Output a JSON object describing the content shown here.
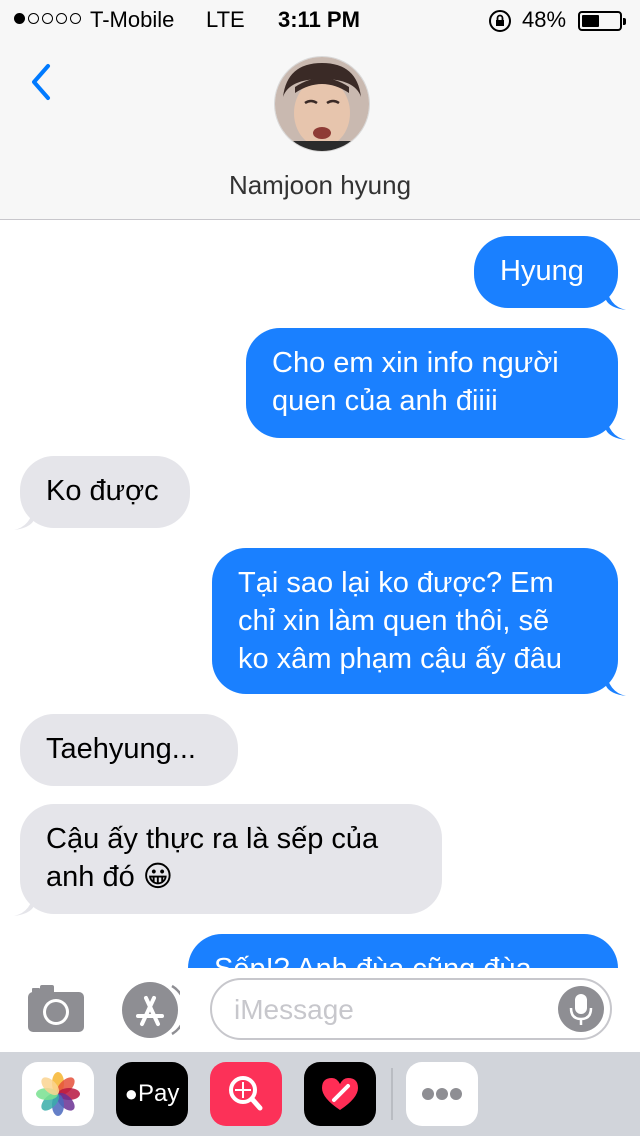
{
  "status_bar": {
    "carrier": "T-Mobile",
    "network": "LTE",
    "time": "3:11 PM",
    "battery": "48%",
    "battery_level": 0.48,
    "signal_bars": 1
  },
  "header": {
    "contact_name": "Namjoon hyung",
    "back_icon": "chevron-left-icon"
  },
  "messages": [
    {
      "direction": "out",
      "text": "Hyung"
    },
    {
      "direction": "out",
      "text": "Cho em xin info người\nquen của anh điiii"
    },
    {
      "direction": "in",
      "text": "Ko được"
    },
    {
      "direction": "out",
      "text": "Tại sao lại ko được? Em\nchỉ xin làm quen thôi, sẽ\nko xâm phạm cậu ấy đâu"
    },
    {
      "direction": "in",
      "text": "Taehyung..."
    },
    {
      "direction": "in",
      "text": "Cậu ấy thực ra là sếp của\nanh đó 😀"
    },
    {
      "direction": "out",
      "text": "Sếp!? Anh đùa cũng đùa"
    }
  ],
  "input_bar": {
    "placeholder": "iMessage",
    "camera_icon": "camera-icon",
    "appstore_icon": "app-store-icon",
    "mic_icon": "microphone-icon"
  },
  "app_drawer": {
    "apps": [
      "photos-icon",
      "apple-pay-icon",
      "web-images-icon",
      "digital-touch-icon",
      "more-icon"
    ],
    "apple_pay_label": "Pay"
  },
  "colors": {
    "outgoing_bubble": "#1a80ff",
    "incoming_bubble": "#e5e5ea",
    "accent": "#007aff"
  }
}
